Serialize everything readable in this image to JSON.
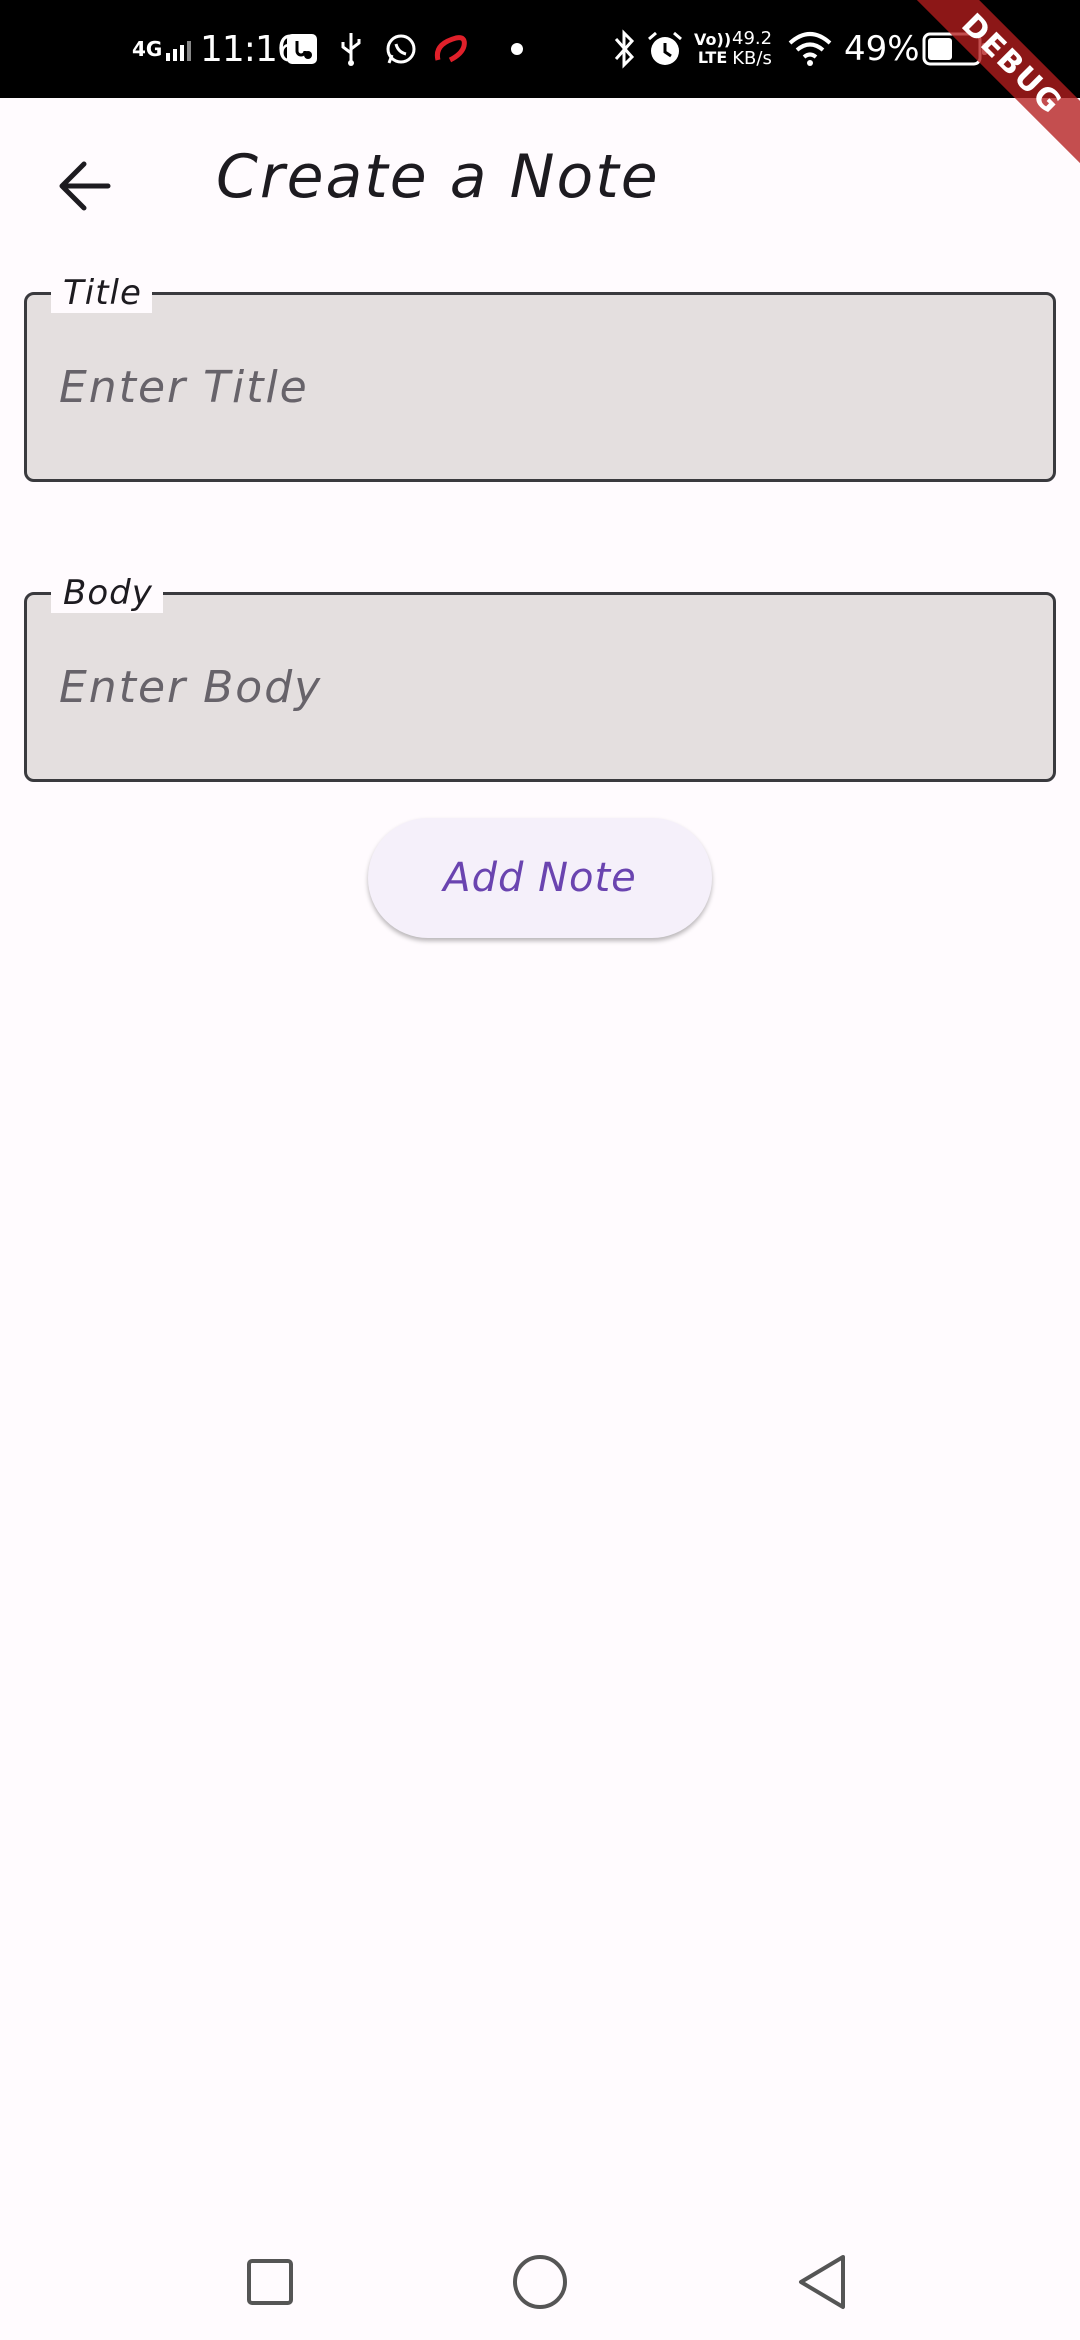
{
  "status_bar": {
    "network": "4G",
    "time": "11:16",
    "volte": "Vo))",
    "lte": "LTE",
    "speed_value": "49.2",
    "speed_unit": "KB/s",
    "battery_percent": "49%",
    "icons": [
      "signal-icon",
      "usb-settings-icon",
      "usb-icon",
      "whatsapp-icon",
      "airtel-icon",
      "dot-icon",
      "bluetooth-icon",
      "alarm-icon",
      "wifi-icon",
      "battery-icon"
    ]
  },
  "debug_banner": "DEBUG",
  "app_bar": {
    "back_icon": "arrow-back-icon",
    "title": "Create a Note"
  },
  "form": {
    "title_field": {
      "label": "Title",
      "placeholder": "Enter Title",
      "value": ""
    },
    "body_field": {
      "label": "Body",
      "placeholder": "Enter Body",
      "value": ""
    },
    "add_button_label": "Add Note"
  },
  "nav_bar": {
    "icons": [
      "recents-square-icon",
      "home-circle-icon",
      "back-triangle-icon"
    ]
  },
  "colors": {
    "background": "#fffbfe",
    "field_fill": "#e4dfdf",
    "button_text": "#6a44b0",
    "debug_ribbon": "#b41e1e"
  }
}
